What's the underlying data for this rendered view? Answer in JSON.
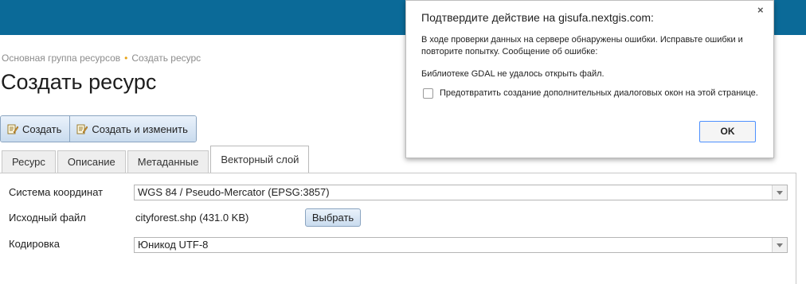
{
  "breadcrumb": {
    "items": [
      "Основная группа ресурсов",
      "Создать ресурс"
    ],
    "separator": "•"
  },
  "page": {
    "title": "Создать ресурс"
  },
  "toolbar": {
    "create_label": "Создать",
    "create_edit_label": "Создать и изменить",
    "icon": "document-edit-icon"
  },
  "tabs": [
    {
      "label": "Ресурс",
      "active": false
    },
    {
      "label": "Описание",
      "active": false
    },
    {
      "label": "Метаданные",
      "active": false
    },
    {
      "label": "Векторный слой",
      "active": true
    }
  ],
  "form": {
    "crs": {
      "label": "Система координат",
      "value": "WGS 84 / Pseudo-Mercator (EPSG:3857)"
    },
    "source_file": {
      "label": "Исходный файл",
      "value": "cityforest.shp (431.0 KB)",
      "button_label": "Выбрать"
    },
    "encoding": {
      "label": "Кодировка",
      "value": "Юникод UTF-8"
    }
  },
  "dialog": {
    "title": "Подтвердите действие на gisufa.nextgis.com:",
    "close": "×",
    "message": "В ходе проверки данных на сервере обнаружены ошибки. Исправьте ошибки и повторите попытку. Сообщение об ошибке:",
    "error": "Библиотеке GDAL не удалось открыть файл.",
    "checkbox_label": "Предотвратить создание дополнительных диалоговых окон на этой странице.",
    "checkbox_checked": false,
    "ok_label": "OK"
  },
  "colors": {
    "topbar": "#0b6a98",
    "breadcrumb_separator": "#e8a317",
    "button_gradient_top": "#eaf2fb",
    "button_gradient_bottom": "#c9dbee",
    "ok_border": "#4d90fe"
  }
}
